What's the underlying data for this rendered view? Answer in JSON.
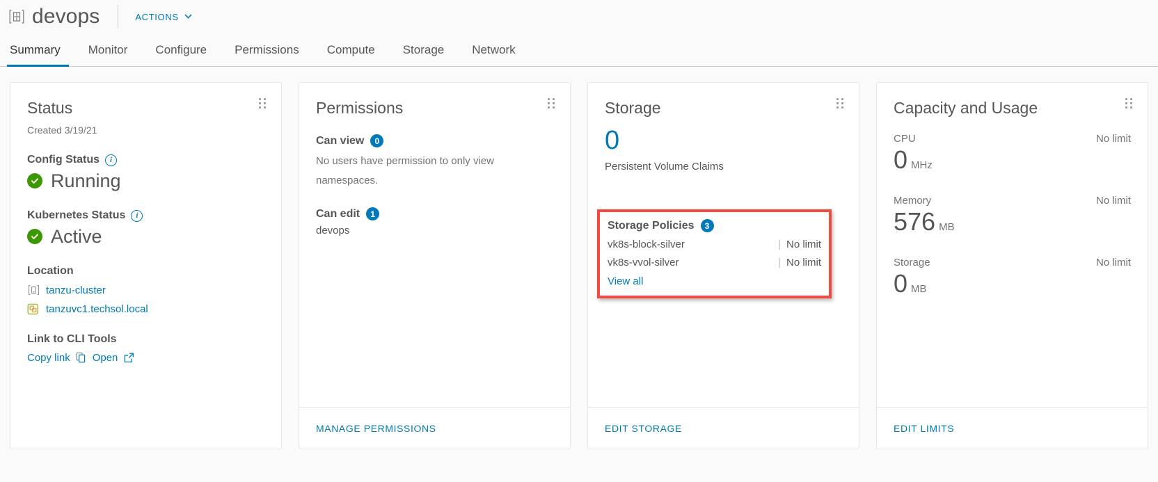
{
  "header": {
    "namespace_icon": "namespace-icon",
    "title": "devops",
    "actions_label": "ACTIONS",
    "actions_caret": "∨"
  },
  "tabs": [
    {
      "label": "Summary",
      "active": true
    },
    {
      "label": "Monitor",
      "active": false
    },
    {
      "label": "Configure",
      "active": false
    },
    {
      "label": "Permissions",
      "active": false
    },
    {
      "label": "Compute",
      "active": false
    },
    {
      "label": "Storage",
      "active": false
    },
    {
      "label": "Network",
      "active": false
    }
  ],
  "status_card": {
    "title": "Status",
    "created": "Created 3/19/21",
    "config_status_label": "Config Status",
    "config_status_value": "Running",
    "kubernetes_status_label": "Kubernetes Status",
    "kubernetes_status_value": "Active",
    "location_label": "Location",
    "cluster_name": "tanzu-cluster",
    "vcenter_name": "tanzuvc1.techsol.local",
    "cli_label": "Link to CLI Tools",
    "copy_link_label": "Copy link",
    "open_label": "Open"
  },
  "permissions_card": {
    "title": "Permissions",
    "can_view_label": "Can view",
    "can_view_count": "0",
    "can_view_text": "No users have permission to only view namespaces.",
    "can_edit_label": "Can edit",
    "can_edit_count": "1",
    "can_edit_user": "devops",
    "footer_label": "MANAGE PERMISSIONS"
  },
  "storage_card": {
    "title": "Storage",
    "pvc_count": "0",
    "pvc_label": "Persistent Volume Claims",
    "policies_label": "Storage Policies",
    "policies_count": "3",
    "policies": [
      {
        "name": "vk8s-block-silver",
        "limit": "No limit"
      },
      {
        "name": "vk8s-vvol-silver",
        "limit": "No limit"
      }
    ],
    "view_all_label": "View all",
    "footer_label": "EDIT STORAGE",
    "highlight_color": "#f24c41"
  },
  "capacity_card": {
    "title": "Capacity and Usage",
    "metrics": [
      {
        "label": "CPU",
        "limit": "No limit",
        "value": "0",
        "unit": "MHz"
      },
      {
        "label": "Memory",
        "limit": "No limit",
        "value": "576",
        "unit": "MB"
      },
      {
        "label": "Storage",
        "limit": "No limit",
        "value": "0",
        "unit": "MB"
      }
    ],
    "footer_label": "EDIT LIMITS"
  },
  "colors": {
    "accent": "#0079b8",
    "success": "#3c9700",
    "highlight": "#f24c41",
    "text": "#565656",
    "muted": "#737373"
  }
}
